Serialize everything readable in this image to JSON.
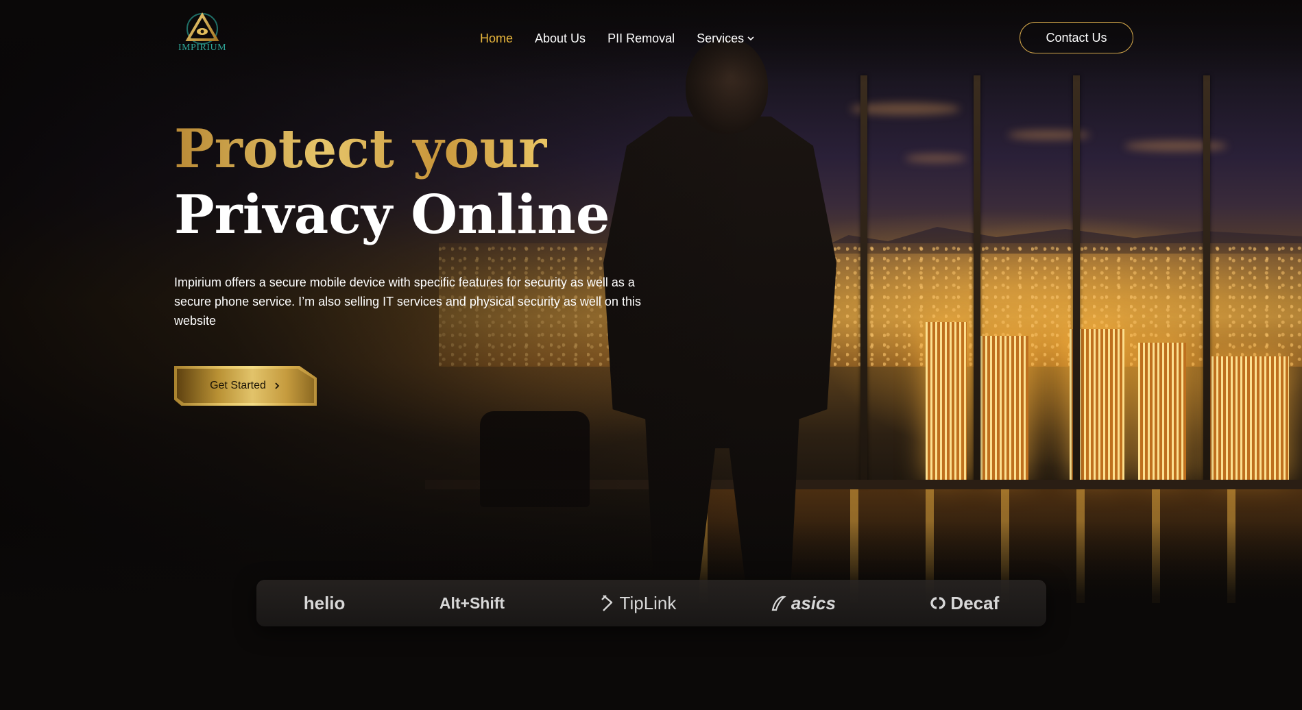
{
  "brand": {
    "logo_text": "IMPIRIUM"
  },
  "nav": {
    "links": [
      {
        "label": "Home",
        "active": true
      },
      {
        "label": "About Us",
        "active": false
      },
      {
        "label": "PII Removal",
        "active": false
      },
      {
        "label": "Services",
        "active": false,
        "has_dropdown": true
      }
    ],
    "contact_label": "Contact Us"
  },
  "hero": {
    "title_line1": "Protect your",
    "title_line2": "Privacy Online",
    "description": "Impirium offers a secure mobile device with specific features for security as well as a secure phone service. I’m also selling IT services and physical security as well on this website",
    "cta_label": "Get Started"
  },
  "partners": [
    {
      "name": "helio",
      "icon": "helio-wordmark"
    },
    {
      "name": "Alt+Shift",
      "icon": "altshift-wordmark"
    },
    {
      "name": "TipLink",
      "icon": "tiplink-icon"
    },
    {
      "name": "asics",
      "icon": "asics-stripe-icon"
    },
    {
      "name": "Decaf",
      "icon": "decaf-icon"
    }
  ],
  "colors": {
    "accent_gold": "#e8b63c",
    "background": "#0b0908",
    "button_border": "#d6a94b",
    "logo_teal": "#2fa89a"
  }
}
